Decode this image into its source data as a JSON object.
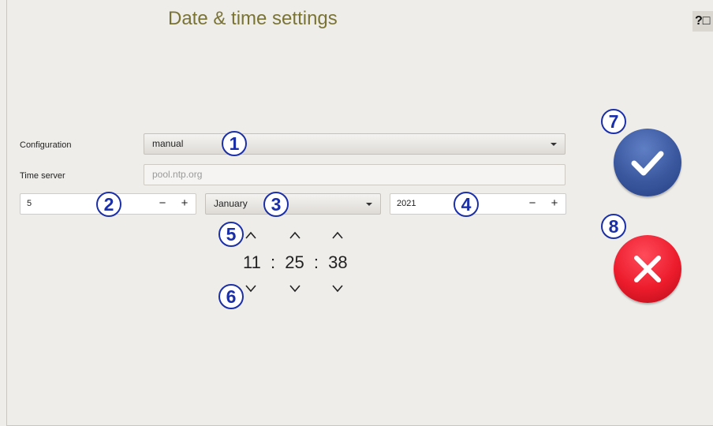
{
  "header": {
    "title": "Date & time settings",
    "help_label": "?□"
  },
  "configuration": {
    "label": "Configuration",
    "value": "manual"
  },
  "time_server": {
    "label": "Time server",
    "placeholder": "pool.ntp.org"
  },
  "date": {
    "day": {
      "value": "5",
      "minus": "−",
      "plus": "+"
    },
    "month": {
      "value": "January"
    },
    "year": {
      "value": "2021",
      "minus": "−",
      "plus": "+"
    }
  },
  "time": {
    "hours": "11",
    "minutes": "25",
    "seconds": "38",
    "separator": ":"
  },
  "callouts": [
    "1",
    "2",
    "3",
    "4",
    "5",
    "6",
    "7",
    "8"
  ],
  "actions": {
    "confirm_icon": "checkmark-icon",
    "cancel_icon": "close-icon"
  },
  "colors": {
    "title": "#7a7434",
    "callout": "#1b2fa8",
    "confirm": "#3a579e",
    "cancel": "#ec1c2c",
    "background": "#efedea"
  }
}
